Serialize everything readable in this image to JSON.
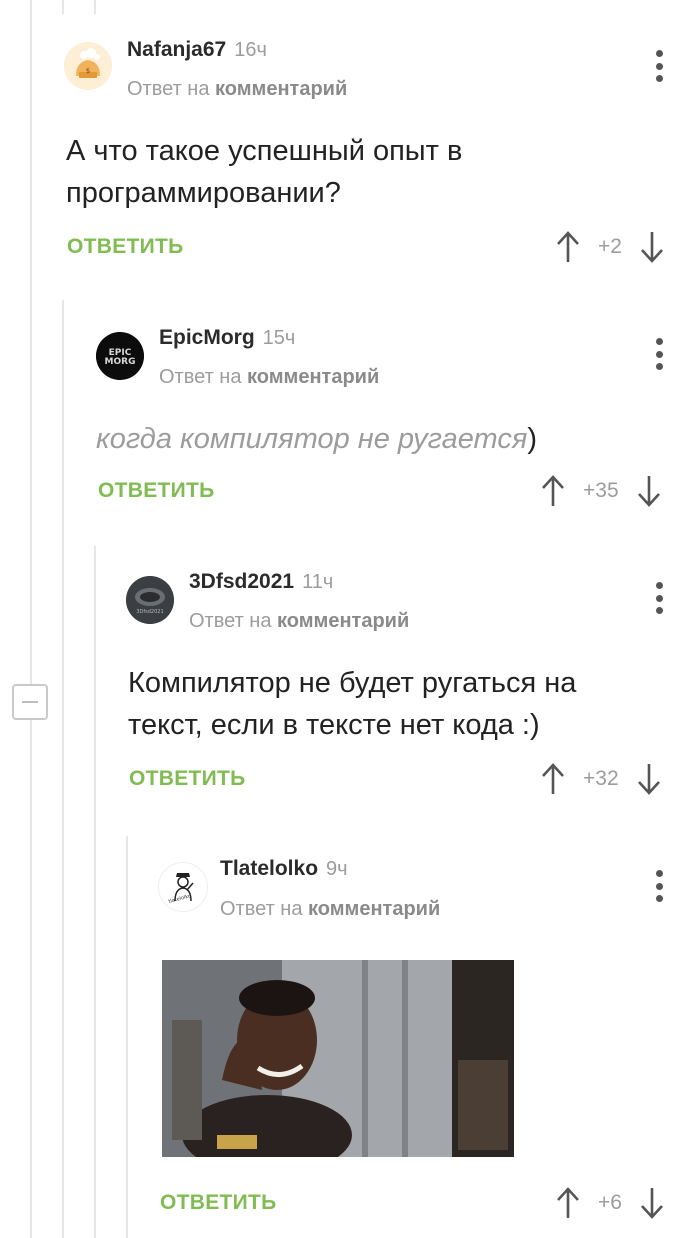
{
  "comments": [
    {
      "author": "Nafanja67",
      "time": "16ч",
      "reply_prefix": "Ответ на",
      "reply_link": "комментарий",
      "text": "А что такое успешный опыт в программировании?",
      "reply_label": "ОТВЕТИТЬ",
      "score": "+2"
    },
    {
      "author": "EpicMorg",
      "time": "15ч",
      "reply_prefix": "Ответ на",
      "reply_link": "комментарий",
      "text": "когда компилятор не ругается",
      "text_tail": ")",
      "reply_label": "ОТВЕТИТЬ",
      "score": "+35",
      "avatar_text": "EPIC MORG"
    },
    {
      "author": "3Dfsd2021",
      "time": "11ч",
      "reply_prefix": "Ответ на",
      "reply_link": "комментарий",
      "text": "Компилятор не будет ругаться на текст, если в тексте нет кода :)",
      "reply_label": "ОТВЕТИТЬ",
      "score": "+32"
    },
    {
      "author": "Tlatelolko",
      "time": "9ч",
      "reply_prefix": "Ответ на",
      "reply_link": "комментарий",
      "reply_label": "ОТВЕТИТЬ",
      "score": "+6"
    }
  ],
  "colors": {
    "accent_green": "#80bc53",
    "muted": "#9c9c9c",
    "thread_line": "#e6e6e6"
  },
  "icons": [
    "kebab-menu-icon",
    "upvote-arrow-icon",
    "downvote-arrow-icon",
    "collapse-minus-icon"
  ]
}
